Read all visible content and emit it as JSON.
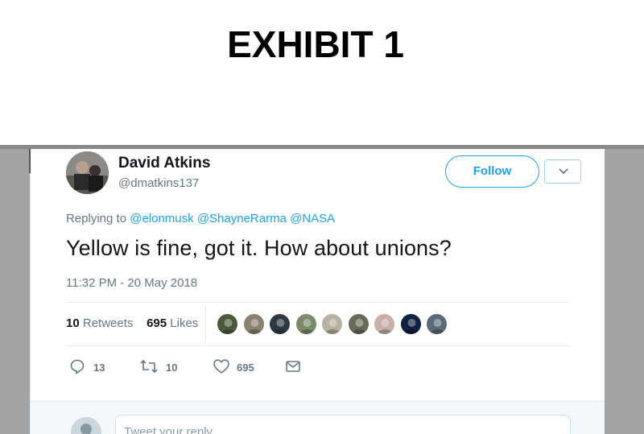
{
  "exhibit": {
    "title": "EXHIBIT 1"
  },
  "tweet": {
    "display_name": "David Atkins",
    "handle": "@dmatkins137",
    "follow_label": "Follow",
    "replying_prefix": "Replying to",
    "mentions": [
      "@elonmusk",
      "@ShayneRarma",
      "@NASA"
    ],
    "text": "Yellow is fine, got it. How about unions?",
    "timestamp": "11:32 PM - 20 May 2018"
  },
  "stats": {
    "retweets_count": "10",
    "retweets_label": "Retweets",
    "likes_count": "695",
    "likes_label": "Likes"
  },
  "likers": {
    "colors": [
      "#4a5a3a",
      "#8a8070",
      "#2d3a44",
      "#7a8a6a",
      "#b8b0a0",
      "#6a6a5a",
      "#c8b0a8",
      "#102040",
      "#5a6a7a"
    ]
  },
  "actions": {
    "reply_count": "13",
    "retweet_count": "10",
    "like_count": "695"
  },
  "reply_box": {
    "placeholder": "Tweet your reply"
  },
  "colors": {
    "twitter_blue": "#1da1f2",
    "secondary_text": "#657786",
    "primary_text": "#14171a",
    "backdrop": "#a3a3a3"
  },
  "icons": [
    "reply-icon",
    "retweet-icon",
    "heart-icon",
    "mail-icon",
    "chevron-down-icon"
  ]
}
